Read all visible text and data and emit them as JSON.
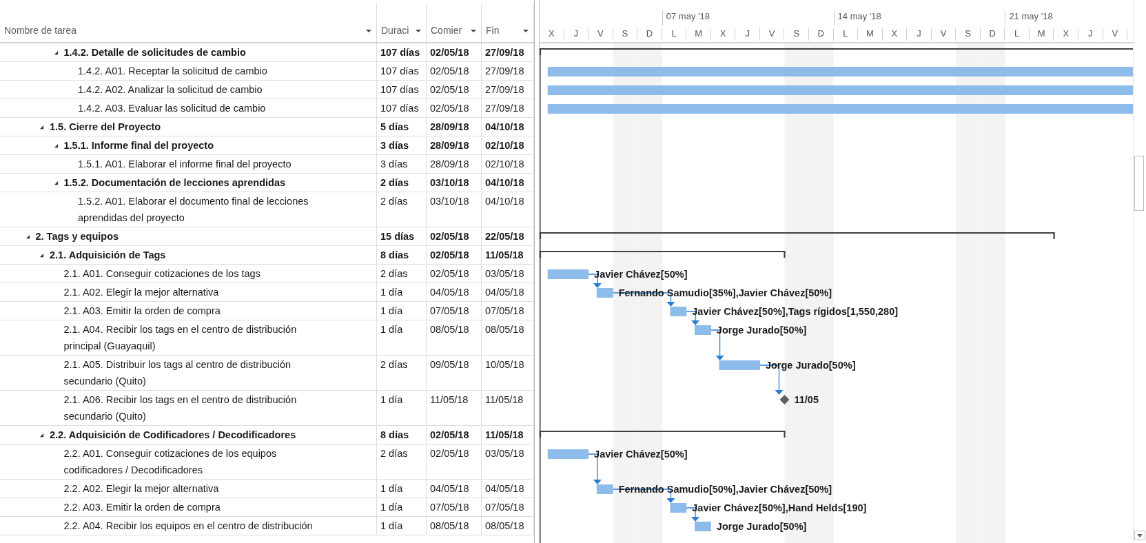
{
  "table": {
    "columns": [
      {
        "label": "Nombre de tarea"
      },
      {
        "label": "Duraci"
      },
      {
        "label": "Comier"
      },
      {
        "label": "Fin"
      }
    ],
    "tasks": [
      {
        "children": [
          {
            "children": [
              {
                "kind": "summary",
                "name": "1.4.2. Detalle de solicitudes de cambio",
                "duration": "107 días",
                "start": "02/05/18",
                "finish": "27/09/18",
                "expanded": true,
                "children": [
                  {
                    "kind": "task",
                    "name": "1.4.2. A01. Receptar la solicitud de cambio",
                    "duration": "107 días",
                    "start": "02/05/18",
                    "finish": "27/09/18"
                  },
                  {
                    "kind": "task",
                    "name": "1.4.2. A02. Analizar la solicitud de cambio",
                    "duration": "107 días",
                    "start": "02/05/18",
                    "finish": "27/09/18"
                  },
                  {
                    "kind": "task",
                    "name": "1.4.2. A03. Evaluar las solicitud de cambio",
                    "duration": "107 días",
                    "start": "02/05/18",
                    "finish": "27/09/18"
                  }
                ]
              }
            ]
          },
          {
            "kind": "summary",
            "name": "1.5. Cierre del Proyecto",
            "duration": "5 días",
            "start": "28/09/18",
            "finish": "04/10/18",
            "expanded": true,
            "children": [
              {
                "kind": "summary",
                "name": "1.5.1. Informe final del proyecto",
                "duration": "3 días",
                "start": "28/09/18",
                "finish": "02/10/18",
                "expanded": true,
                "children": [
                  {
                    "kind": "task",
                    "name": "1.5.1. A01. Elaborar el informe final del proyecto",
                    "duration": "3 días",
                    "start": "28/09/18",
                    "finish": "02/10/18"
                  }
                ]
              },
              {
                "kind": "summary",
                "name": "1.5.2. Documentación de lecciones aprendidas",
                "duration": "2 días",
                "start": "03/10/18",
                "finish": "04/10/18",
                "expanded": true,
                "children": [
                  {
                    "kind": "task",
                    "name": "1.5.2. A01. Elaborar el documento final de lecciones aprendidas del proyecto",
                    "duration": "2 días",
                    "start": "03/10/18",
                    "finish": "04/10/18"
                  }
                ]
              }
            ]
          }
        ]
      },
      {
        "kind": "summary",
        "name": "2. Tags y equipos",
        "duration": "15 días",
        "start": "02/05/18",
        "finish": "22/05/18",
        "expanded": true,
        "children": [
          {
            "kind": "summary",
            "name": "2.1. Adquisición de Tags",
            "duration": "8 días",
            "start": "02/05/18",
            "finish": "11/05/18",
            "expanded": true,
            "children": [
              {
                "kind": "task",
                "name": "2.1. A01. Conseguir cotizaciones de los tags",
                "duration": "2 días",
                "start": "02/05/18",
                "finish": "03/05/18",
                "bar_label": "Javier Chávez[50%]"
              },
              {
                "kind": "task",
                "name": "2.1. A02. Elegir la mejor alternativa",
                "duration": "1 día",
                "start": "04/05/18",
                "finish": "04/05/18",
                "bar_label": "Fernando Samudio[35%],Javier Chávez[50%]"
              },
              {
                "kind": "task",
                "name": "2.1. A03. Emitir la orden de compra",
                "duration": "1 día",
                "start": "07/05/18",
                "finish": "07/05/18",
                "bar_label": "Javier Chávez[50%],Tags rígidos[1,550,280]"
              },
              {
                "kind": "task",
                "name": "2.1. A04. Recibir los tags en el centro de distribución principal (Guayaquil)",
                "duration": "1 día",
                "start": "08/05/18",
                "finish": "08/05/18",
                "bar_label": "Jorge Jurado[50%]"
              },
              {
                "kind": "task",
                "name": "2.1. A05. Distribuir los tags al centro de distribución secundario (Quito)",
                "duration": "2 días",
                "start": "09/05/18",
                "finish": "10/05/18",
                "bar_label": "Jorge Jurado[50%]"
              },
              {
                "kind": "milestone",
                "name": "2.1. A06. Recibir los tags en el centro de distribución secundario (Quito)",
                "duration": "1 día",
                "start": "11/05/18",
                "finish": "11/05/18",
                "bar_label": "11/05"
              }
            ]
          },
          {
            "kind": "summary",
            "name": "2.2. Adquisición de Codificadores / Decodificadores",
            "duration": "8 días",
            "start": "02/05/18",
            "finish": "11/05/18",
            "expanded": true,
            "children": [
              {
                "kind": "task",
                "name": "2.2. A01. Conseguir cotizaciones de los equipos codificadores / Decodificadores",
                "duration": "2 días",
                "start": "02/05/18",
                "finish": "03/05/18",
                "bar_label": "Javier Chávez[50%]"
              },
              {
                "kind": "task",
                "name": "2.2. A02. Elegir la mejor alternativa",
                "duration": "1 día",
                "start": "04/05/18",
                "finish": "04/05/18",
                "bar_label": "Fernando Samudio[50%],Javier Chávez[50%]"
              },
              {
                "kind": "task",
                "name": "2.2. A03. Emitir la orden de compra",
                "duration": "1 día",
                "start": "07/05/18",
                "finish": "07/05/18",
                "bar_label": "Javier Chávez[50%],Hand Helds[190]"
              },
              {
                "kind": "task",
                "name": "2.2. A04. Recibir los equipos en el centro de distribución",
                "duration": "1 día",
                "start": "08/05/18",
                "finish": "08/05/18",
                "bar_label": "Jorge Jurado[50%]"
              }
            ]
          }
        ]
      }
    ]
  },
  "timescale": {
    "weeks": [
      {
        "days": [
          {
            "label": "X",
            "nonworking": false
          },
          {
            "label": "J",
            "nonworking": false
          },
          {
            "label": "V",
            "nonworking": false
          },
          {
            "label": "S",
            "nonworking": true
          },
          {
            "label": "D",
            "nonworking": true
          }
        ]
      },
      {
        "label": "07 may '18",
        "days": [
          {
            "label": "L",
            "nonworking": false
          },
          {
            "label": "M",
            "nonworking": false
          },
          {
            "label": "X",
            "nonworking": false
          },
          {
            "label": "J",
            "nonworking": false
          },
          {
            "label": "V",
            "nonworking": false
          },
          {
            "label": "S",
            "nonworking": true
          },
          {
            "label": "D",
            "nonworking": true
          }
        ]
      },
      {
        "label": "14 may '18",
        "days": [
          {
            "label": "L",
            "nonworking": false
          },
          {
            "label": "M",
            "nonworking": false
          },
          {
            "label": "X",
            "nonworking": false
          },
          {
            "label": "J",
            "nonworking": false
          },
          {
            "label": "V",
            "nonworking": false
          },
          {
            "label": "S",
            "nonworking": true
          },
          {
            "label": "D",
            "nonworking": true
          }
        ]
      },
      {
        "label": "21 may '18",
        "days": [
          {
            "label": "L",
            "nonworking": false
          },
          {
            "label": "M",
            "nonworking": false
          },
          {
            "label": "X",
            "nonworking": false
          },
          {
            "label": "J",
            "nonworking": false
          },
          {
            "label": "V",
            "nonworking": false
          }
        ]
      }
    ]
  }
}
